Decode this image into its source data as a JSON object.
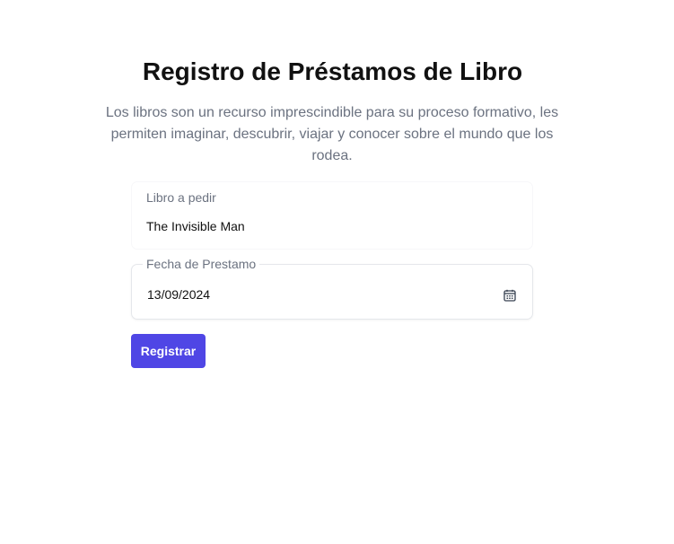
{
  "page": {
    "title": "Registro de Préstamos de Libro",
    "subtitle": "Los libros son un recurso imprescindible para su proceso formativo, les permiten imaginar, descubrir, viajar y conocer sobre el mundo que los rodea."
  },
  "form": {
    "book": {
      "label": "Libro a pedir",
      "value": "The Invisible Man"
    },
    "date": {
      "label": "Fecha de Prestamo",
      "value": "13/09/2024",
      "icon": "calendar-icon"
    },
    "submit_label": "Registrar"
  },
  "colors": {
    "accent": "#4f46e5",
    "muted_text": "#6b7280",
    "text": "#111111"
  }
}
